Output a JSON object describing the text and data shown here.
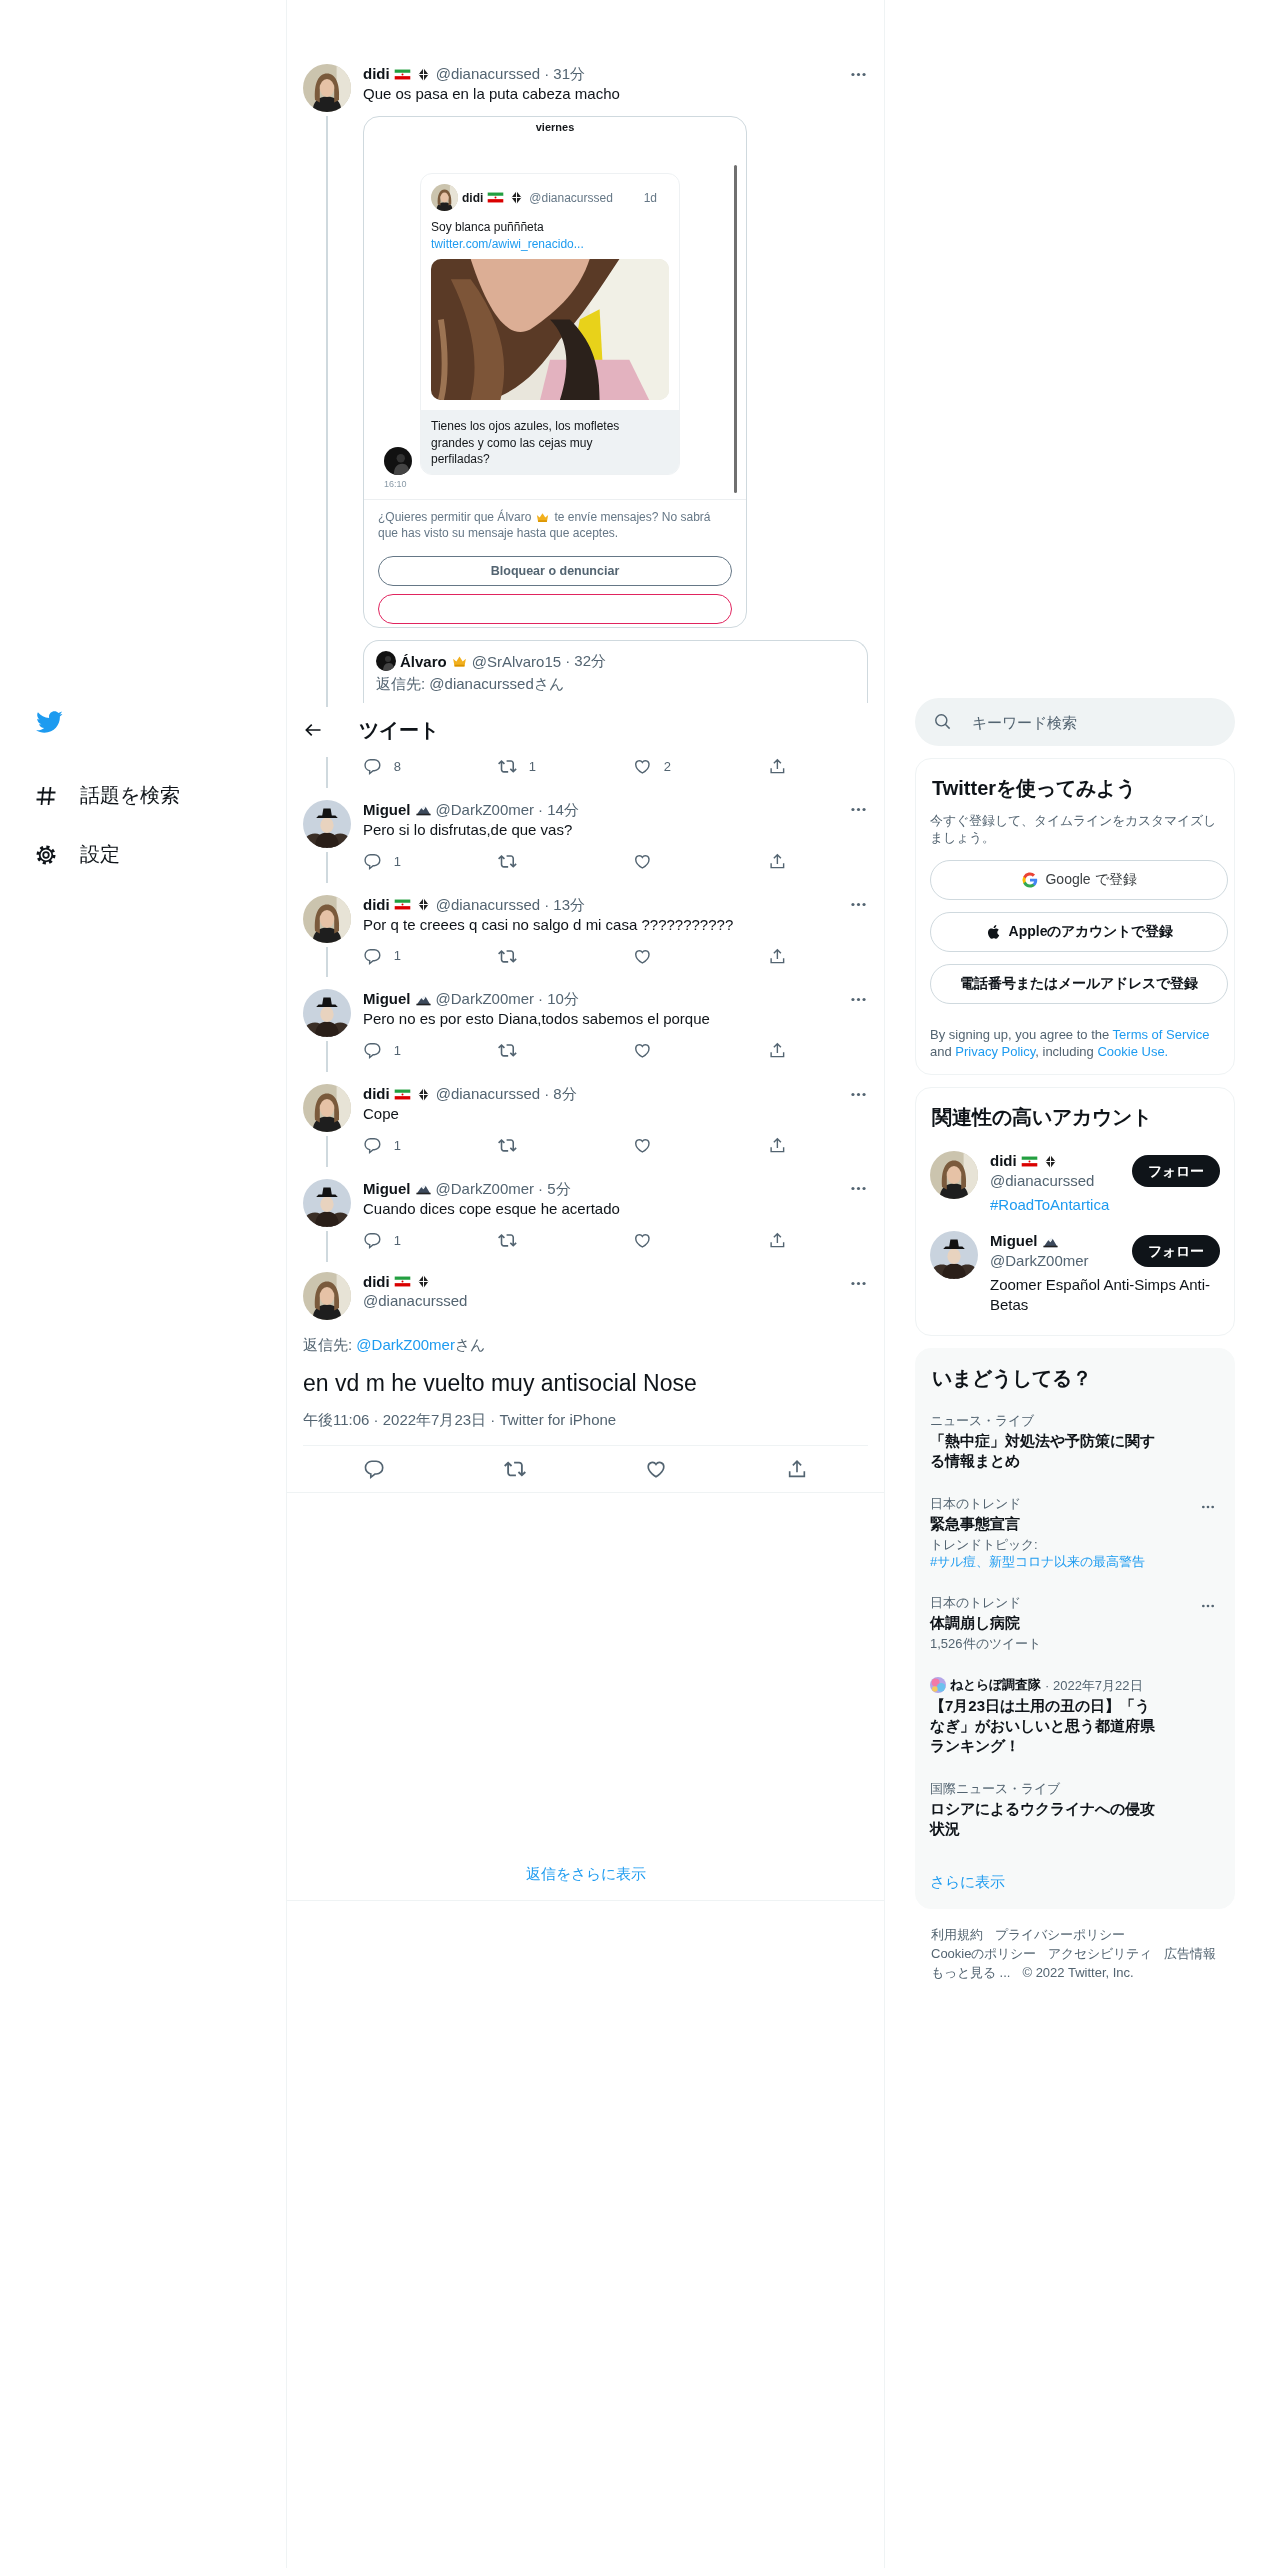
{
  "sidebar": {
    "items": [
      {
        "kind": "hash",
        "label": "話題を検索"
      },
      {
        "kind": "gear",
        "label": "設定"
      }
    ]
  },
  "thread": {
    "first_tweet": {
      "author": {
        "name": "didi",
        "badges": [
          {
            "kind": "flag"
          },
          {
            "kind": "crosshair"
          }
        ],
        "handle": "@dianacurssed",
        "time": "· 31分",
        "avatar": {
          "kind": "hair"
        }
      },
      "text": "Que os pasa en la puta cabeza macho",
      "image": {
        "kind": "screenshot",
        "day": "viernes",
        "card": {
          "name": "didi",
          "badges": [
            {
              "kind": "flag"
            },
            {
              "kind": "crosshair"
            }
          ],
          "handle": "@dianacurssed",
          "time": "1d",
          "avatar": {
            "kind": "hair"
          },
          "text": "Soy blanca puñññeta",
          "link": "twitter.com/awiwi_renacido..."
        },
        "message": "Tienes los ojos azules, los mofletes grandes y como las cejas muy perfiladas?",
        "sender_avatar": {
          "kind": "dark"
        },
        "message_time": "16:10",
        "request_before": "¿Quieres permitir que Álvaro",
        "request_badge": {
          "kind": "crown"
        },
        "request_after": "te envíe mensajes? No sabrá",
        "request_line2": "que has visto su mensaje hasta que aceptes.",
        "button": "Bloquear o denunciar"
      },
      "quote": {
        "author": {
          "name": "Álvaro",
          "badges": [
            {
              "kind": "crown"
            }
          ],
          "handle": "@SrAlvaro15",
          "time": "· 32分",
          "avatar": {
            "kind": "dark"
          }
        },
        "reply_to": "返信先: @dianacurssedさん"
      }
    },
    "header": {
      "title": "ツイート"
    },
    "context_actions": [
      {
        "kind": "reply",
        "count": "8"
      },
      {
        "kind": "retweet",
        "count": "1"
      },
      {
        "kind": "like",
        "count": "2"
      },
      {
        "kind": "share"
      }
    ],
    "replies": [
      {
        "author": {
          "name": "Miguel",
          "badges": [
            {
              "kind": "mountain"
            }
          ],
          "handle": "@DarkZ00mer",
          "time": "· 14分",
          "avatar": {
            "kind": "hat"
          }
        },
        "text": "Pero si lo disfrutas,de que vas?",
        "actions": [
          {
            "kind": "reply",
            "count": "1"
          },
          {
            "kind": "retweet"
          },
          {
            "kind": "like"
          },
          {
            "kind": "share"
          }
        ]
      },
      {
        "author": {
          "name": "didi",
          "badges": [
            {
              "kind": "flag"
            },
            {
              "kind": "crosshair"
            }
          ],
          "handle": "@dianacurssed",
          "time": "· 13分",
          "avatar": {
            "kind": "hair"
          }
        },
        "text": "Por q te creees q casi no salgo d mi casa ???????????",
        "actions": [
          {
            "kind": "reply",
            "count": "1"
          },
          {
            "kind": "retweet"
          },
          {
            "kind": "like"
          },
          {
            "kind": "share"
          }
        ]
      },
      {
        "author": {
          "name": "Miguel",
          "badges": [
            {
              "kind": "mountain"
            }
          ],
          "handle": "@DarkZ00mer",
          "time": "· 10分",
          "avatar": {
            "kind": "hat"
          }
        },
        "text": "Pero no es por esto Diana,todos sabemos el porque",
        "actions": [
          {
            "kind": "reply",
            "count": "1"
          },
          {
            "kind": "retweet"
          },
          {
            "kind": "like"
          },
          {
            "kind": "share"
          }
        ]
      },
      {
        "author": {
          "name": "didi",
          "badges": [
            {
              "kind": "flag"
            },
            {
              "kind": "crosshair"
            }
          ],
          "handle": "@dianacurssed",
          "time": "· 8分",
          "avatar": {
            "kind": "hair"
          }
        },
        "text": "Cope",
        "actions": [
          {
            "kind": "reply",
            "count": "1"
          },
          {
            "kind": "retweet"
          },
          {
            "kind": "like"
          },
          {
            "kind": "share"
          }
        ]
      },
      {
        "author": {
          "name": "Miguel",
          "badges": [
            {
              "kind": "mountain"
            }
          ],
          "handle": "@DarkZ00mer",
          "time": "· 5分",
          "avatar": {
            "kind": "hat"
          }
        },
        "text": "Cuando dices cope esque he acertado",
        "actions": [
          {
            "kind": "reply",
            "count": "1"
          },
          {
            "kind": "retweet"
          },
          {
            "kind": "like"
          },
          {
            "kind": "share"
          }
        ]
      }
    ],
    "main_tweet": {
      "author": {
        "name": "didi",
        "badges": [
          {
            "kind": "flag"
          },
          {
            "kind": "crosshair"
          }
        ],
        "handle": "@dianacurssed",
        "avatar": {
          "kind": "hair"
        }
      },
      "reply_prefix": "返信先: ",
      "reply_link": "@DarkZ00mer",
      "reply_suffix": "さん",
      "text": "en vd m he vuelto muy antisocial Nose",
      "meta": "午後11:06 · 2022年7月23日 · Twitter for iPhone",
      "actions": [
        {
          "kind": "reply"
        },
        {
          "kind": "retweet"
        },
        {
          "kind": "like"
        },
        {
          "kind": "share"
        }
      ]
    },
    "show_more": "返信をさらに表示"
  },
  "search": {
    "placeholder": "キーワード検索"
  },
  "signup": {
    "title": "Twitterを使ってみよう",
    "description": "今すぐ登録して、タイムラインをカスタマイズしましょう。",
    "buttons": [
      {
        "kind": "google",
        "label": "Google で登録"
      },
      {
        "kind": "apple",
        "label": "Appleのアカウントで登録"
      },
      {
        "kind": "plain",
        "label": "電話番号またはメールアドレスで登録"
      }
    ],
    "legal": [
      {
        "text": "By signing up, you agree to the ",
        "link": false
      },
      {
        "text": "Terms of Service",
        "link": true
      },
      {
        "text": " and ",
        "link": false
      },
      {
        "text": "Privacy Policy",
        "link": true
      },
      {
        "text": ", including ",
        "link": false
      },
      {
        "text": "Cookie Use.",
        "link": true
      }
    ]
  },
  "who_to_follow": {
    "title": "関連性の高いアカウント",
    "accounts": [
      {
        "name": "didi",
        "badges": [
          {
            "kind": "flag"
          },
          {
            "kind": "crosshair"
          }
        ],
        "handle": "@dianacurssed",
        "avatar": {
          "kind": "hair"
        },
        "bio": {
          "kind": "hashtag",
          "text": "#RoadToAntartica"
        },
        "button": "フォロー"
      },
      {
        "name": "Miguel",
        "badges": [
          {
            "kind": "mountain"
          }
        ],
        "handle": "@DarkZ00mer",
        "avatar": {
          "kind": "hat"
        },
        "bio": {
          "kind": "text",
          "text": "Zoomer Español Anti-Simps Anti-Betas"
        },
        "button": "フォロー"
      }
    ]
  },
  "trends": {
    "title": "いまどうしてる？",
    "items": [
      {
        "kind": "news",
        "category": "ニュース・ライブ",
        "title": "「熱中症」対処法や予防策に関する情報まとめ"
      },
      {
        "kind": "trend",
        "category": "日本のトレンド",
        "title": "緊急事態宣言",
        "sub_prefix": "トレンドトピック: ",
        "sub_link": "#サル痘、新型コロナ以来の最高警告"
      },
      {
        "kind": "trend",
        "category": "日本のトレンド",
        "title": "体調崩し病院",
        "sub_prefix": "1,526件のツイート"
      },
      {
        "kind": "article",
        "source": "ねとらぼ調査隊",
        "date": "· 2022年7月22日",
        "title": "【7月23日は土用の丑の日】「うなぎ」がおいしいと思う都道府県ランキング！"
      },
      {
        "kind": "news",
        "category": "国際ニュース・ライブ",
        "title": "ロシアによるウクライナへの侵攻状況"
      }
    ],
    "show_more": "さらに表示"
  },
  "footer": {
    "lines": [
      [
        "利用規約",
        "プライバシーポリシー"
      ],
      [
        "Cookieのポリシー",
        "アクセシビリティ",
        "広告情報"
      ],
      [
        "もっと見る ..."
      ]
    ],
    "copyright": "© 2022 Twitter, Inc."
  }
}
